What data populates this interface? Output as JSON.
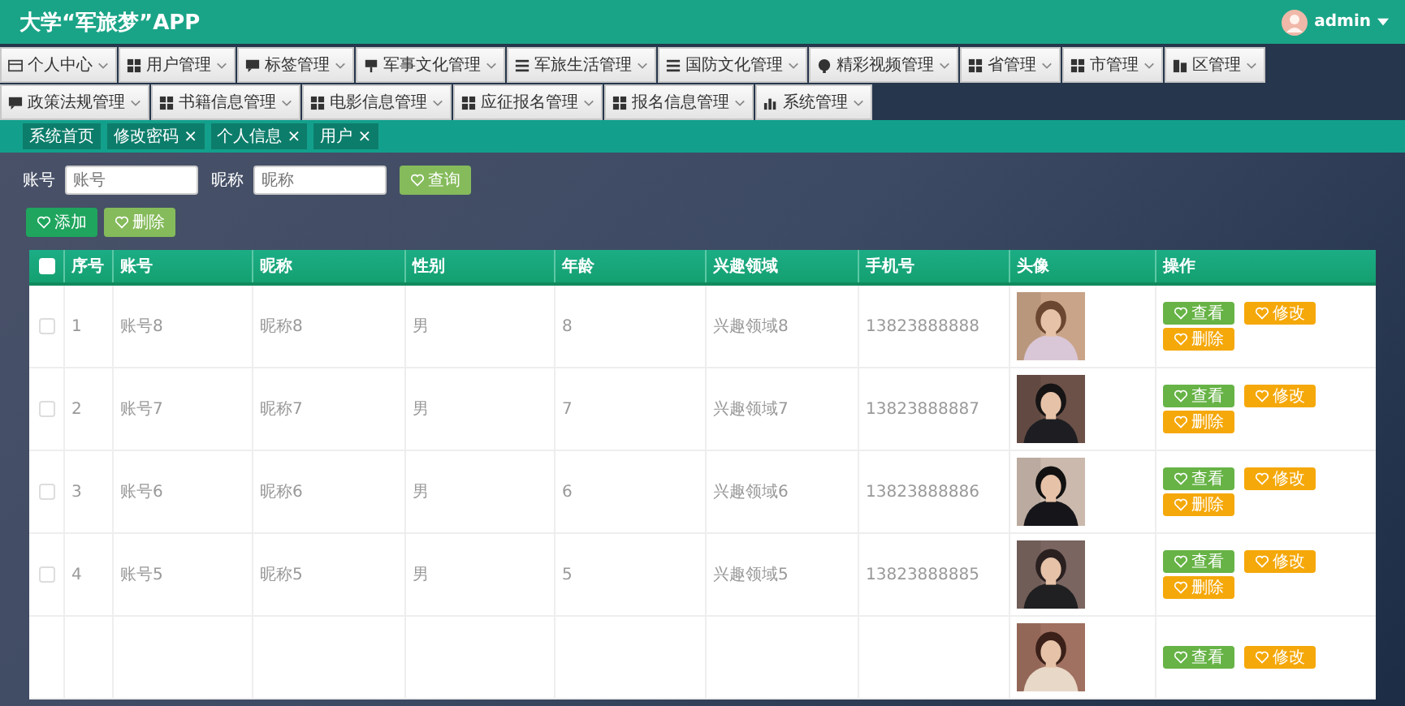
{
  "header": {
    "title": "大学“军旅梦”APP",
    "user": "admin"
  },
  "menu": [
    "个人中心",
    "用户管理",
    "标签管理",
    "军事文化管理",
    "军旅生活管理",
    "国防文化管理",
    "精彩视频管理",
    "省管理",
    "市管理",
    "区管理",
    "政策法规管理",
    "书籍信息管理",
    "电影信息管理",
    "应征报名管理",
    "报名信息管理",
    "系统管理"
  ],
  "tabs": [
    {
      "label": "系统首页"
    },
    {
      "label": "修改密码",
      "close": "×"
    },
    {
      "label": "个人信息",
      "close": "×"
    },
    {
      "label": "用户",
      "close": "×"
    }
  ],
  "search": {
    "fields": [
      {
        "label": "账号",
        "placeholder": "账号"
      },
      {
        "label": "昵称",
        "placeholder": "昵称"
      }
    ],
    "button": "查询"
  },
  "toolbar": [
    {
      "kind": "add",
      "label": "添加"
    },
    {
      "kind": "delete",
      "label": "删除"
    }
  ],
  "table": {
    "select_all": {
      "checked": false
    },
    "columns": [
      "序号",
      "账号",
      "昵称",
      "性别",
      "年龄",
      "兴趣领域",
      "手机号",
      "头像",
      "操作"
    ],
    "rows": [
      {
        "checked": false,
        "cells": [
          "1",
          "账号8",
          "昵称8",
          "男",
          "8",
          "兴趣领域8",
          "13823888888"
        ],
        "avatar": {
          "kind": "picture"
        },
        "actions": [
          {
            "kind": "view",
            "label": "查看"
          },
          {
            "kind": "edit",
            "label": "修改"
          },
          {
            "kind": "delete",
            "label": "删除"
          }
        ]
      },
      {
        "checked": false,
        "cells": [
          "2",
          "账号7",
          "昵称7",
          "男",
          "7",
          "兴趣领域7",
          "13823888887"
        ],
        "avatar": {
          "kind": "picture"
        },
        "actions": [
          {
            "kind": "view",
            "label": "查看"
          },
          {
            "kind": "edit",
            "label": "修改"
          },
          {
            "kind": "delete",
            "label": "删除"
          }
        ]
      },
      {
        "checked": false,
        "cells": [
          "3",
          "账号6",
          "昵称6",
          "男",
          "6",
          "兴趣领域6",
          "13823888886"
        ],
        "avatar": {
          "kind": "picture"
        },
        "actions": [
          {
            "kind": "view",
            "label": "查看"
          },
          {
            "kind": "edit",
            "label": "修改"
          },
          {
            "kind": "delete",
            "label": "删除"
          }
        ]
      },
      {
        "checked": false,
        "cells": [
          "4",
          "账号5",
          "昵称5",
          "男",
          "5",
          "兴趣领域5",
          "13823888885"
        ],
        "avatar": {
          "kind": "picture"
        },
        "actions": [
          {
            "kind": "view",
            "label": "查看"
          },
          {
            "kind": "edit",
            "label": "修改"
          },
          {
            "kind": "delete",
            "label": "删除"
          }
        ]
      },
      {
        "cells": [],
        "avatar": {
          "kind": "picture"
        },
        "actions": [
          {
            "kind": "view",
            "label": "查看"
          },
          {
            "kind": "edit",
            "label": "修改"
          }
        ]
      }
    ]
  }
}
